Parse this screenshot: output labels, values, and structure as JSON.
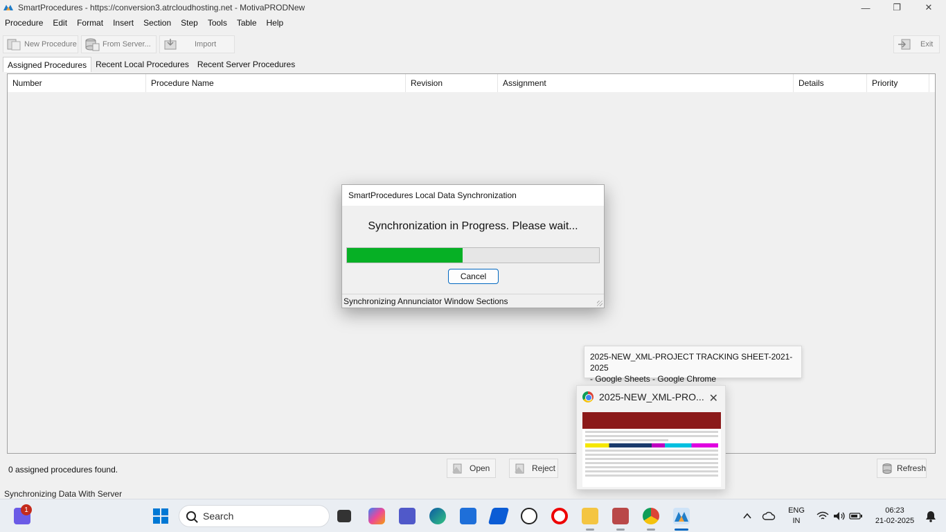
{
  "window": {
    "title": "SmartProcedures - https://conversion3.atrcloudhosting.net - MotivaPRODNew",
    "minimize": "—",
    "maximize": "❐",
    "close": "✕"
  },
  "menu": [
    "Procedure",
    "Edit",
    "Format",
    "Insert",
    "Section",
    "Step",
    "Tools",
    "Table",
    "Help"
  ],
  "toolbar": {
    "new_procedure": "New Procedure",
    "from_server": "From Server...",
    "import": "Import",
    "exit": "Exit"
  },
  "tabs": [
    "Assigned Procedures",
    "Recent Local Procedures",
    "Recent Server Procedures"
  ],
  "table": {
    "columns": [
      "Number",
      "Procedure Name",
      "Revision",
      "Assignment",
      "Details",
      "Priority"
    ]
  },
  "footer": {
    "count": "0 assigned procedures found.",
    "open": "Open",
    "reject": "Reject",
    "refresh": "Refresh",
    "status": "Synchronizing Data With Server"
  },
  "dialog": {
    "title": "SmartProcedures Local Data Synchronization",
    "message": "Synchronization in Progress.  Please wait...",
    "progress_fraction": 0.46,
    "progress_color": "#06b025",
    "cancel": "Cancel",
    "status": "Synchronizing Annunciator Window Sections"
  },
  "taskbar_preview": {
    "tooltip_line1": "2025-NEW_XML-PROJECT TRACKING SHEET-2021-2025",
    "tooltip_line2": "- Google Sheets - Google Chrome",
    "thumb_title": "2025-NEW_XML-PRO...",
    "close": "✕"
  },
  "taskbar": {
    "search": "Search",
    "notification_count": "1",
    "lang_line1": "ENG",
    "lang_line2": "IN",
    "time": "06:23",
    "date": "21-02-2025"
  }
}
